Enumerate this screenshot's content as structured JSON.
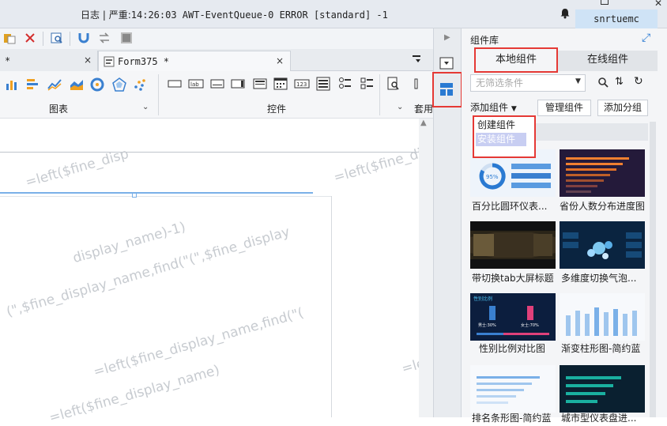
{
  "topbar": {
    "log_label": "日志",
    "log_sep": "|",
    "log_level": "严重:",
    "log_message": "14:26:03 AWT-EventQueue-0 ERROR [standard] -1",
    "username": "snrtuemc"
  },
  "tabs": [
    {
      "label": "*",
      "close": "×"
    },
    {
      "label": "Form375 *",
      "close": "×"
    }
  ],
  "widget_toolbar": {
    "groups": [
      {
        "label": "图表"
      },
      {
        "label": "控件"
      },
      {
        "label": "套用"
      }
    ]
  },
  "watermark": {
    "lines": [
      "=left($fine_disp",
      "=left($fine_dis",
      "display_name)-1)",
      "(\",$fine_display_name,find(\"(\",$fine_display",
      "=left($fine_display_name,find(\"(",
      "=left($fine_display_name)",
      "=le"
    ]
  },
  "panel": {
    "title": "组件库",
    "tabs": {
      "local": "本地组件",
      "online": "在线组件"
    },
    "filter_placeholder": "无筛选条件",
    "add_component": "添加组件",
    "manage_button": "管理组件",
    "add_group_button": "添加分组",
    "dropdown": {
      "create": "创建组件",
      "install": "安装组件"
    },
    "components": [
      {
        "name": "百分比圆环仪表..."
      },
      {
        "name": "省份人数分布进度图"
      },
      {
        "name": "带切换tab大屏标题"
      },
      {
        "name": "多维度切换气泡..."
      },
      {
        "name": "性别比例对比图"
      },
      {
        "name": "渐变柱形图-简约蓝"
      },
      {
        "name": "排名条形图-简约蓝"
      },
      {
        "name": "城市型仪表盘进..."
      }
    ],
    "thumb_texts": {
      "pct": "95%",
      "gender_title": "性别比例",
      "male": "男士:30%",
      "female": "女士:70%"
    }
  },
  "colors": {
    "accent": "#2a7ad2",
    "highlight_red": "#e53935",
    "selection": "#c8cef2"
  }
}
